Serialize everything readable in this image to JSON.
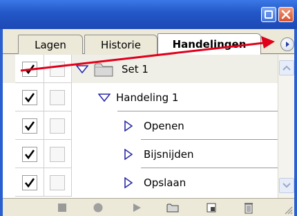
{
  "tabs": [
    {
      "label": "Lagen",
      "active": false
    },
    {
      "label": "Historie",
      "active": false
    },
    {
      "label": "Handelingen",
      "active": true
    }
  ],
  "actions": {
    "set": {
      "label": "Set 1",
      "expanded": true
    },
    "action": {
      "label": "Handeling 1",
      "expanded": true
    },
    "steps": [
      {
        "label": "Openen"
      },
      {
        "label": "Bijsnijden"
      },
      {
        "label": "Opslaan"
      }
    ]
  },
  "colors": {
    "titlebar": "#2356c7",
    "annotation_arrow": "#e0001a",
    "expand_triangle": "#2a2aa8"
  },
  "icons": {
    "window": [
      "minimize-icon",
      "close-icon"
    ],
    "tab_menu": "panel-menu-icon",
    "toolbar": [
      "stop-icon",
      "record-icon",
      "play-icon",
      "new-set-icon",
      "new-action-icon",
      "delete-icon"
    ]
  }
}
